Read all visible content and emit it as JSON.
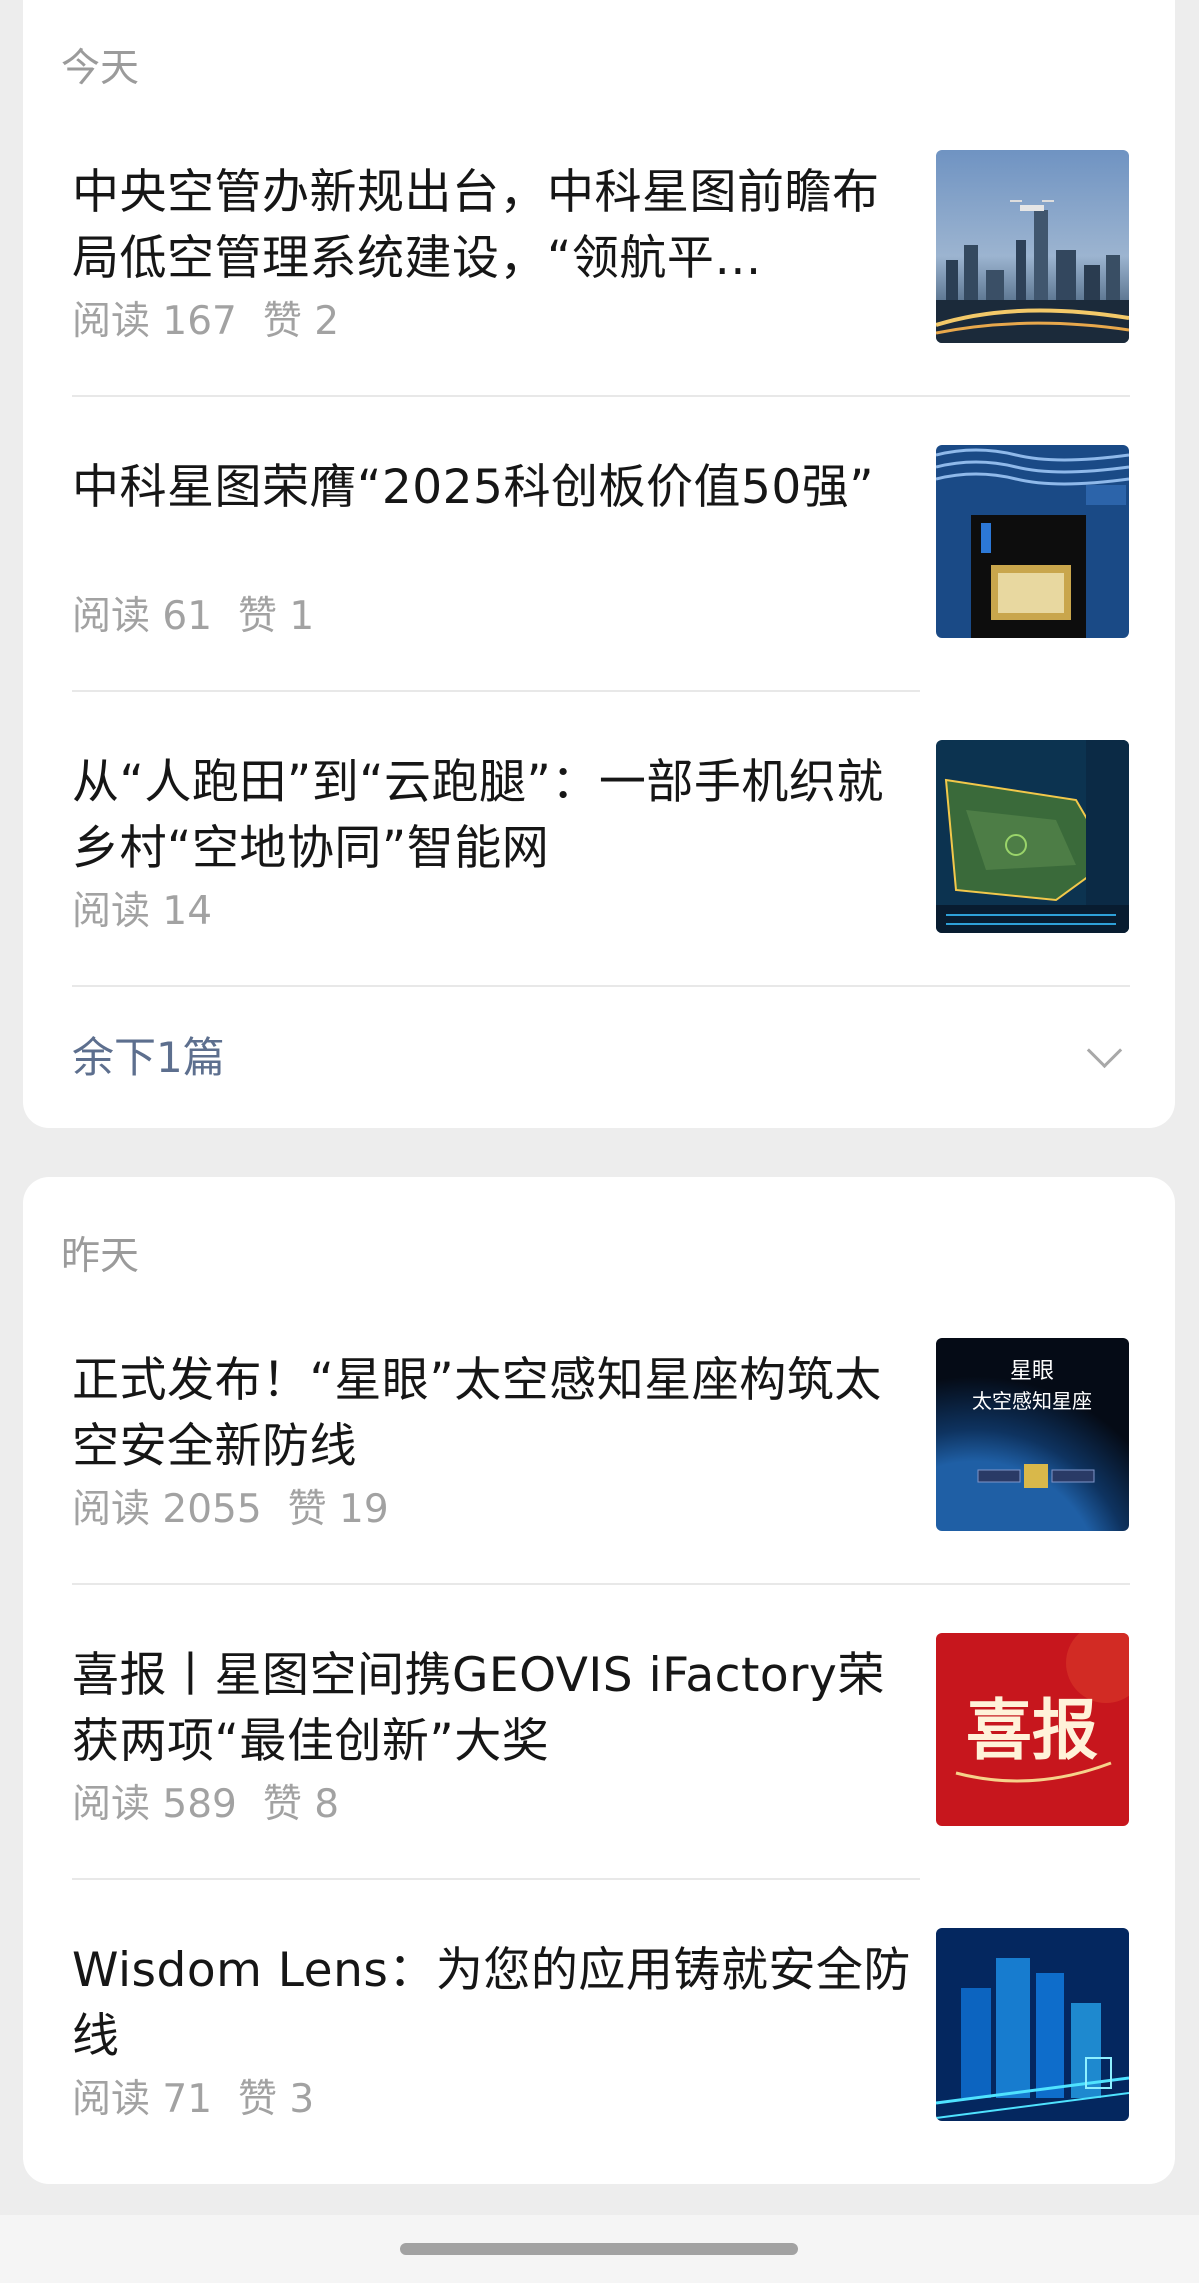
{
  "sections": [
    {
      "label": "今天",
      "articles": [
        {
          "title": "中央空管办新规出台，中科星图前瞻布局低空管理系统建设，“领航平…",
          "reads": "阅读 167",
          "likes": "赞 2",
          "thumb": "city-drone-thumbnail"
        },
        {
          "title": "中科星图荣膺“2025科创板价值50强”",
          "reads": "阅读 61",
          "likes": "赞 1",
          "thumb": "award-trophy-thumbnail"
        },
        {
          "title": "从“人跑田”到“云跑腿”：一部手机织就乡村“空地协同”智能网",
          "reads": "阅读 14",
          "likes": "",
          "thumb": "map-dashboard-thumbnail"
        }
      ],
      "more_label": "余下1篇"
    },
    {
      "label": "昨天",
      "articles": [
        {
          "title": "正式发布！“星眼”太空感知星座构筑太空安全新防线",
          "reads": "阅读 2055",
          "likes": "赞 19",
          "thumb": "satellite-thumbnail",
          "thumb_text": "星眼\n太空感知星座"
        },
        {
          "title": "喜报丨星图空间携GEOVIS iFactory荣获两项“最佳创新”大奖",
          "reads": "阅读 589",
          "likes": "赞 8",
          "thumb": "good-news-thumbnail",
          "thumb_text": "喜报"
        },
        {
          "title": "Wisdom Lens：为您的应用铸就安全防线",
          "reads": "阅读 71",
          "likes": "赞 3",
          "thumb": "digital-city-thumbnail"
        }
      ]
    }
  ],
  "colors": {
    "accent": "#5d6f8e",
    "label": "#9b9b9b",
    "title": "#161616",
    "background": "#ededed"
  }
}
